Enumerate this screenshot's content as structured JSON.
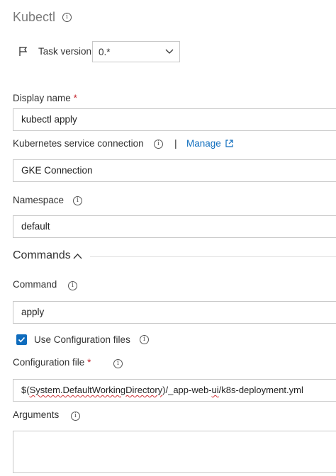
{
  "header": {
    "title": "Kubectl"
  },
  "task_version": {
    "label": "Task version",
    "value": "0.*"
  },
  "display_name": {
    "label": "Display name",
    "required_mark": "*",
    "value": "kubectl apply"
  },
  "service_connection": {
    "label": "Kubernetes service connection",
    "separator": "|",
    "manage_label": "Manage",
    "value": "GKE Connection"
  },
  "namespace": {
    "label": "Namespace",
    "value": "default"
  },
  "commands_section": {
    "label": "Commands"
  },
  "command": {
    "label": "Command",
    "value": "apply"
  },
  "use_config": {
    "label": "Use Configuration files",
    "checked": true
  },
  "config_file": {
    "label": "Configuration file",
    "required_mark": "*",
    "value_prefix": "$(",
    "value_var": "System.DefaultWorkingDirectory",
    "value_mid": ")/_app-web-",
    "value_ui": "ui",
    "value_suffix": "/k8s-deployment.yml"
  },
  "arguments": {
    "label": "Arguments",
    "value": ""
  },
  "colors": {
    "accent": "#106ebe",
    "required": "#c4262e",
    "checkbox": "#0f6cbd"
  }
}
